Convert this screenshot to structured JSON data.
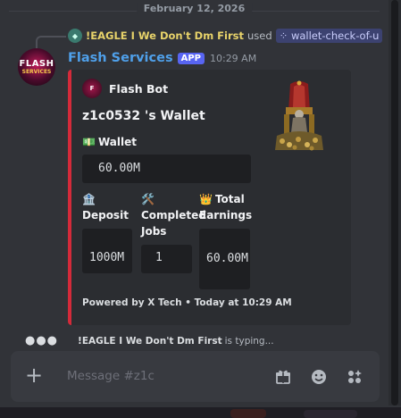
{
  "date_divider": "February 12, 2026",
  "reply": {
    "username": "!EAGLE I We Don't Dm First",
    "used_text": "used",
    "command": "wallet-check-of-u"
  },
  "message": {
    "author": "Flash Services",
    "avatar_text_top": "FLASH",
    "avatar_text_bottom": "SERVICES",
    "tag": "APP",
    "time": "10:29 AM"
  },
  "embed": {
    "accent_color": "#d42a3a",
    "author_name": "Flash Bot",
    "title": "z1c0532 's Wallet",
    "fields": {
      "wallet": {
        "icon": "💵",
        "name": "Wallet",
        "value": "60.00M"
      },
      "deposit": {
        "icon": "🏦",
        "name": "Deposit",
        "value": "1000M"
      },
      "jobs": {
        "icon": "🛠️",
        "name": "Completed Jobs",
        "value": "1"
      },
      "earnings": {
        "icon": "👑",
        "name": "Total Earnings",
        "value": "60.00M"
      }
    },
    "footer": "Powered by X Tech • Today at 10:29 AM",
    "thumbnail_icon": "throne-icon"
  },
  "typing": {
    "username": "!EAGLE I We Don't Dm First",
    "text": "is typing..."
  },
  "composer": {
    "placeholder": "Message #z1c",
    "icons": [
      "plus-icon",
      "gift-icon",
      "emoji-icon",
      "apps-icon"
    ]
  }
}
